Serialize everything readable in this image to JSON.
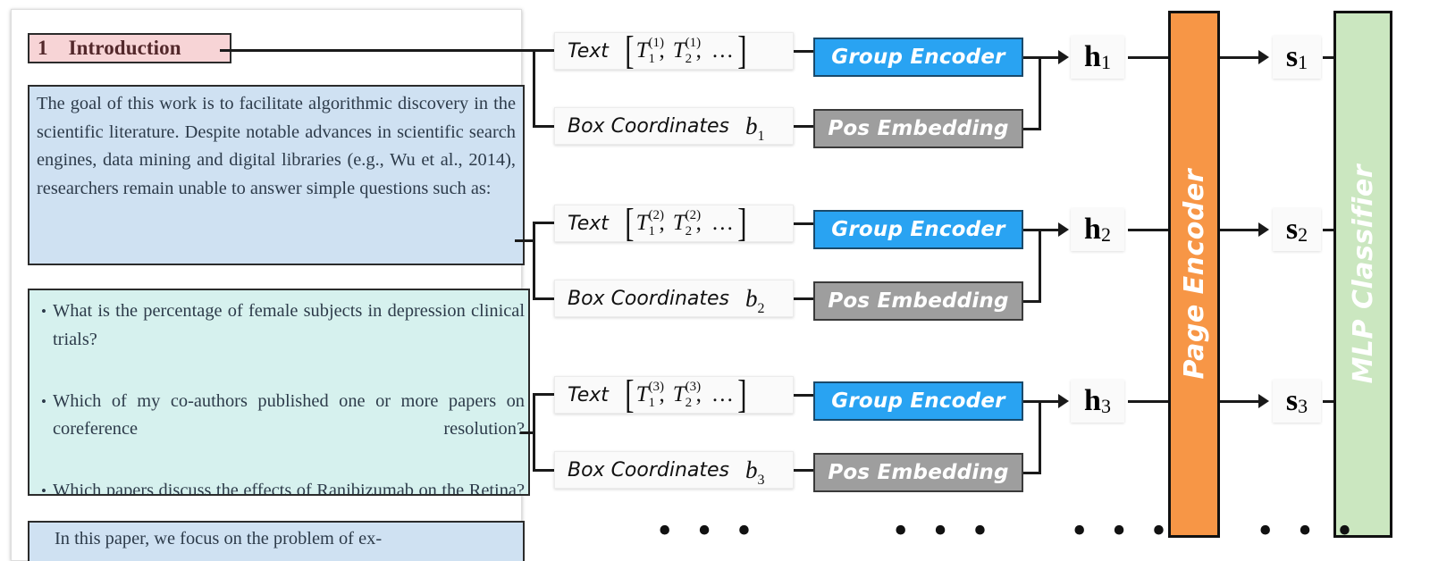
{
  "document": {
    "heading": {
      "number": "1",
      "title": "Introduction"
    },
    "paragraph1": "The goal of this work is to facilitate algorithmic discovery in the scientific literature. Despite notable advances in scientific search engines, data mining and digital libraries (e.g., Wu et al., 2014), researchers remain unable to answer simple questions such as:",
    "bullets": [
      "What is the percentage of female subjects in depression clinical trials?",
      "Which of my co-authors published one or more papers on coreference resolution?",
      "Which papers discuss the effects of Ranibizumab on the Retina?"
    ],
    "bullet_marker": "•",
    "paragraph2": "In this paper, we focus on the problem of ex-",
    "colors": {
      "heading_fill": "#f7d4d6",
      "heading_text": "#53282b",
      "paragraph_fill": "#cfe1f2",
      "bullets_fill": "#d6f1ee",
      "body_text": "#2d3b4a",
      "box_border": "#2b2b2b"
    }
  },
  "pipeline": {
    "rows": [
      {
        "index": "1",
        "text_label": "Text",
        "text_vector": {
          "open": "[",
          "t1_base": "T",
          "t1_sub": "1",
          "t1_sup": "(1)",
          "comma1": ",",
          "t2_base": "T",
          "t2_sub": "2",
          "t2_sup": "(1)",
          "comma2": ",",
          "dots": "…",
          "close": "]"
        },
        "box_label": "Box Coordinates",
        "box_var_base": "b",
        "box_var_sub": "1",
        "group_encoder": "Group Encoder",
        "pos_embedding": "Pos Embedding",
        "hidden_base": "h",
        "hidden_sub": "1",
        "score_base": "s",
        "score_sub": "1"
      },
      {
        "index": "2",
        "text_label": "Text",
        "text_vector": {
          "open": "[",
          "t1_base": "T",
          "t1_sub": "1",
          "t1_sup": "(2)",
          "comma1": ",",
          "t2_base": "T",
          "t2_sub": "2",
          "t2_sup": "(2)",
          "comma2": ",",
          "dots": "…",
          "close": "]"
        },
        "box_label": "Box Coordinates",
        "box_var_base": "b",
        "box_var_sub": "2",
        "group_encoder": "Group Encoder",
        "pos_embedding": "Pos Embedding",
        "hidden_base": "h",
        "hidden_sub": "2",
        "score_base": "s",
        "score_sub": "2"
      },
      {
        "index": "3",
        "text_label": "Text",
        "text_vector": {
          "open": "[",
          "t1_base": "T",
          "t1_sub": "1",
          "t1_sup": "(3)",
          "comma1": ",",
          "t2_base": "T",
          "t2_sub": "2",
          "t2_sup": "(3)",
          "comma2": ",",
          "dots": "…",
          "close": "]"
        },
        "box_label": "Box Coordinates",
        "box_var_base": "b",
        "box_var_sub": "3",
        "group_encoder": "Group Encoder",
        "pos_embedding": "Pos Embedding",
        "hidden_base": "h",
        "hidden_sub": "3",
        "score_base": "s",
        "score_sub": "3"
      }
    ],
    "page_encoder": "Page Encoder",
    "mlp_classifier": "MLP Classifier",
    "continuation_marks": [
      "• • •",
      "• • •",
      "• • •",
      "• • •"
    ],
    "colors": {
      "group_encoder_fill": "#29a3f2",
      "group_encoder_border": "#1a4a6b",
      "pos_embedding_fill": "#9e9e9e",
      "pos_embedding_border": "#3a3a3a",
      "page_encoder_fill": "#f79646",
      "mlp_classifier_fill": "#cbe7c0",
      "connector": "#1a1a1a"
    }
  }
}
